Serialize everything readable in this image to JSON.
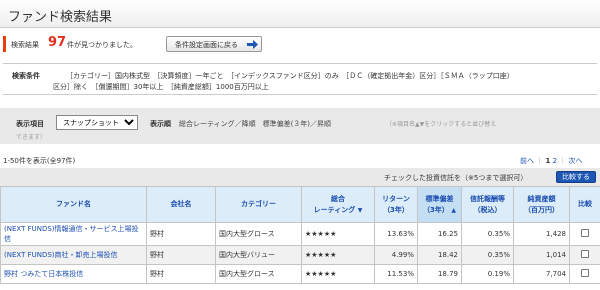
{
  "page": {
    "title": "ファンド検索結果"
  },
  "result": {
    "label": "検索結果",
    "count": "97",
    "suffix": "件が見つかりました。",
    "back_button": "条件設定画面に戻る"
  },
  "conditions": {
    "label": "検索条件",
    "line1": "［カテゴリー］国内株式型　［決算頻度］一年ごと　［インデックスファンド区分］のみ　［ＤＣ（確定拠出年金）区分］［ＳＭＡ（ラップ口座）",
    "line2": "区分］除く　［償還期間］30年以上　［純資産総額］1000百万円以上"
  },
  "display": {
    "items_label": "表示項目",
    "items_value": "スナップショット",
    "order_label": "表示順",
    "order_value": "総合レーティング／降順　標準偏差(３年)／昇順",
    "note": "（※項目名▲▼をクリックすると並び替え",
    "note2": "できます）"
  },
  "list": {
    "range": "1-50件を表示(全97件)",
    "pager_prev": "前へ",
    "pager_page1": "1",
    "pager_page2": "2",
    "pager_next": "次へ",
    "compare_text": "チェックした投資信託を（※5つまで選択可）",
    "compare_button": "比較する"
  },
  "table": {
    "headers": {
      "fund": "ファンド名",
      "company": "会社名",
      "category": "カテゴリー",
      "rating1": "総合",
      "rating2": "レーティング",
      "return1": "リターン",
      "return2": "（3年）",
      "stdev1": "標準偏差",
      "stdev2": "（3年）",
      "fee1": "信託報酬等",
      "fee2": "（税込）",
      "assets1": "純資産額",
      "assets2": "（百万円）",
      "compare": "比較"
    },
    "rows": [
      {
        "fund": "(NEXT FUNDS)情報通信・サービス上場投信",
        "company": "野村",
        "category": "国内大型グロース",
        "rating": "★★★★★",
        "return": "13.63%",
        "stdev": "16.25",
        "fee": "0.35%",
        "assets": "1,428"
      },
      {
        "fund": "(NEXT FUNDS)商社・卸売上場投信",
        "company": "野村",
        "category": "国内大型バリュー",
        "rating": "★★★★★",
        "return": "4.99%",
        "stdev": "18.42",
        "fee": "0.35%",
        "assets": "1,014"
      },
      {
        "fund": "野村 つみたて日本株投信",
        "company": "野村",
        "category": "国内大型グロース",
        "rating": "★★★★★",
        "return": "11.53%",
        "stdev": "18.79",
        "fee": "0.19%",
        "assets": "7,704"
      }
    ]
  },
  "colors": {
    "accent": "#e8400c",
    "count": "#e0301e",
    "link": "#1a4db0",
    "header_bg": "#dcecf8",
    "button_blue": "#1e57b3"
  },
  "icons": {
    "back_arrow": "arrow-right-icon",
    "sort": "sort-triangle-icon"
  }
}
